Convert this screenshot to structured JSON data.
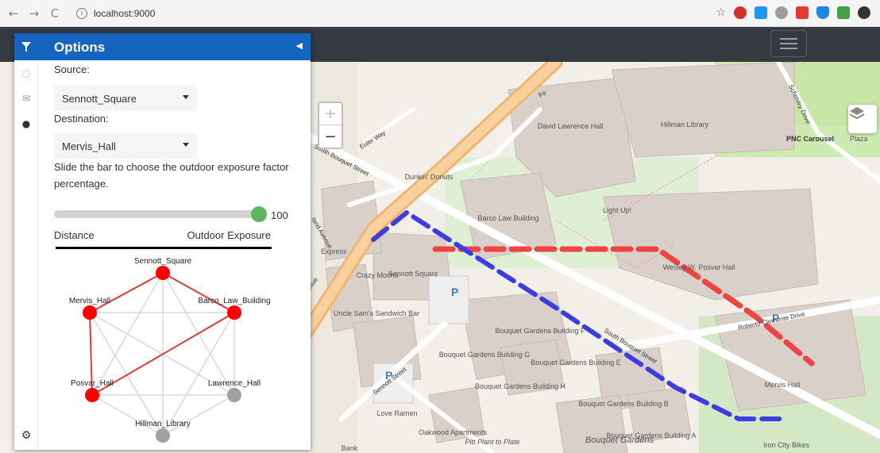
{
  "browser": {
    "url": "localhost:9000",
    "back": "←",
    "forward": "→",
    "reload": "C",
    "info": "i"
  },
  "sidebar": {
    "title": "Options",
    "source_label": "Source:",
    "source_value": "Sennott_Square",
    "destination_label": "Destination:",
    "destination_value": "Mervis_Hall",
    "slider_hint": "Slide the bar to choose the outdoor exposure factor percentage.",
    "slider_value": "100",
    "slider_level": 1.0,
    "left_label": "Distance",
    "right_label": "Outdoor Exposure",
    "active_tab_color": "#1565c0"
  },
  "graph": {
    "nodes": [
      {
        "name": "Sennott_Square",
        "color": "red"
      },
      {
        "name": "Mervis_Hall",
        "color": "red"
      },
      {
        "name": "Barco_Law_Building",
        "color": "red"
      },
      {
        "name": "Posvar_Hall",
        "color": "red"
      },
      {
        "name": "Lawrence_Hall",
        "color": "gray"
      },
      {
        "name": "Hillman_Library",
        "color": "gray"
      }
    ],
    "path": [
      "Sennott_Square",
      "Barco_Law_Building",
      "Posvar_Hall",
      "Mervis_Hall",
      "Sennott_Square"
    ]
  },
  "map": {
    "labels": {
      "david_lawrence": "David Lawrence Hall",
      "hillman": "Hillman Library",
      "pnc": "PNC Carousel",
      "plaza": "Plaza",
      "barco": "Barco Law Building",
      "sennott": "Sennott Square",
      "wesley": "Wesley W. Posvar Hall",
      "mervis": "Mervis Hall",
      "bouquet_g": "Bouquet Gardens Building G",
      "bouquet_f": "Bouquet Gardens Building F",
      "bouquet_e": "Bouquet Gardens Building E",
      "bouquet_h": "Bouquet Gardens Building H",
      "bouquet_b": "Bouquet Gardens Building B",
      "bouquet_a": "Bouquet Gardens Building A",
      "bouquet_bottom": "Bouquet Gardens",
      "oakwood": "Oakwood Apartments",
      "uncle_sams": "Uncle Sam's Sandwich Bar",
      "crazy_mocha": "Crazy Mocha",
      "dunkin": "Dunkin' Donuts",
      "love_ramen": "Love Ramen",
      "pitt_plant": "Pitt Plant to Plate",
      "iron_city": "Iron City Bikes",
      "light_up": "Light Up!",
      "express": "Express",
      "bank": "Bank",
      "parking": "P"
    },
    "streets": {
      "euler": "Euler Way",
      "south_bouquet": "South Bouquet Street",
      "forbes": "Fo",
      "schenley": "Schenley Drive",
      "roberto": "Roberto Clemente Drive",
      "sennott_st": "Sennott Street",
      "bouquet_st": "South Bouquet Street",
      "oakland_ave": "land Avenue",
      "avenue": "venue"
    },
    "route_colors": {
      "distance": "#ef4444",
      "exposure": "#3b3be8"
    }
  }
}
